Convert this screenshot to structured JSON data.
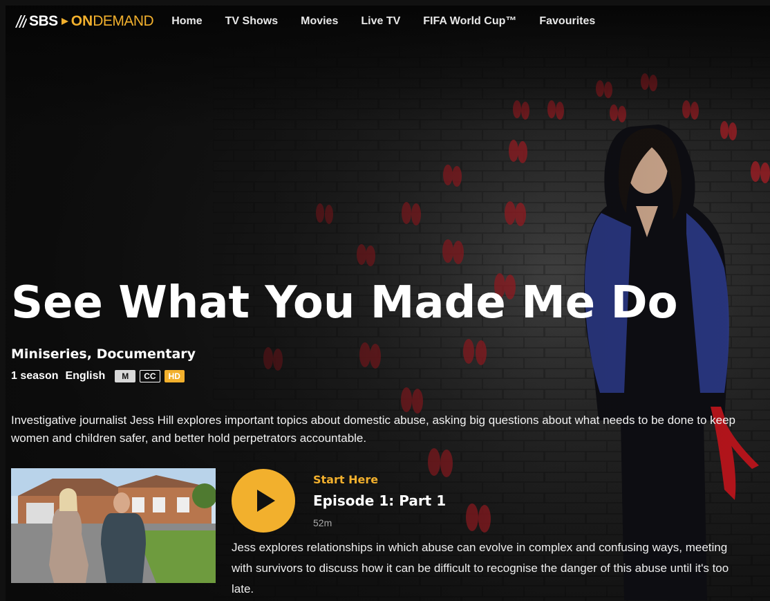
{
  "brand": {
    "sbs": "SBS",
    "on": "ON",
    "demand": "DEMAND",
    "accent": "#f2b02d"
  },
  "nav": {
    "items": [
      {
        "label": "Home"
      },
      {
        "label": "TV Shows"
      },
      {
        "label": "Movies"
      },
      {
        "label": "Live TV"
      },
      {
        "label": "FIFA World Cup™"
      },
      {
        "label": "Favourites"
      }
    ]
  },
  "show": {
    "title": "See What You Made Me Do",
    "genres": "Miniseries, Documentary",
    "seasons": "1 season",
    "language": "English",
    "badges": {
      "rating": "M",
      "cc": "CC",
      "hd": "HD"
    },
    "description": "Investigative journalist Jess Hill explores important topics about domestic abuse, asking big questions about what needs to be done to keep women and children safer, and better hold perpetrators accountable."
  },
  "episode": {
    "label": "Start Here",
    "title": "Episode 1: Part 1",
    "duration": "52m",
    "description": "Jess explores relationships in which abuse can evolve in complex and confusing ways, meeting with survivors to discuss how it can be difficult to recognise the danger of this abuse until it's too late.",
    "play_icon": "play-icon"
  }
}
